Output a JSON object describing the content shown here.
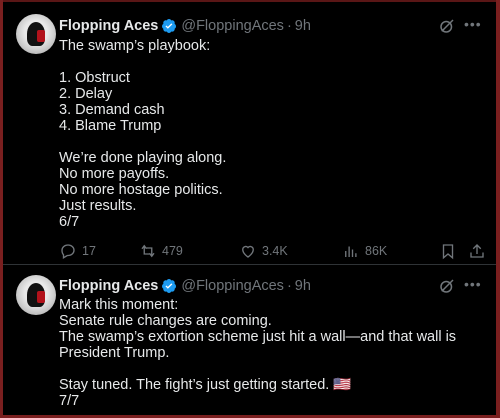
{
  "posts": [
    {
      "author_name": "Flopping Aces",
      "handle": "@FloppingAces",
      "separator": "·",
      "time": "9h",
      "text": "The swamp’s playbook:\n\n1. Obstruct\n2. Delay\n3. Demand cash\n4. Blame Trump\n\nWe’re done playing along.\nNo more payoffs.\nNo more hostage politics.\nJust results.\n6/7",
      "metrics": {
        "replies": "17",
        "reposts": "479",
        "likes": "3.4K",
        "views": "86K"
      }
    },
    {
      "author_name": "Flopping Aces",
      "handle": "@FloppingAces",
      "separator": "·",
      "time": "9h",
      "text": "Mark this moment:\nSenate rule changes are coming.\nThe swamp’s extortion scheme just hit a wall—and that wall is President Trump.\n\nStay tuned. The fight’s just getting started. 🇺🇸\n7/7"
    }
  ],
  "icons": {
    "verified": "verified-badge-icon",
    "grok": "grok-icon",
    "more": "more-icon",
    "reply": "reply-icon",
    "repost": "repost-icon",
    "like": "like-icon",
    "views": "views-icon",
    "bookmark": "bookmark-icon",
    "share": "share-icon"
  },
  "colors": {
    "background": "#000000",
    "text": "#e7e9ea",
    "muted": "#71767b",
    "verified": "#1d9bf0",
    "divider": "#2f3336",
    "frame": "#7a1f1f"
  }
}
